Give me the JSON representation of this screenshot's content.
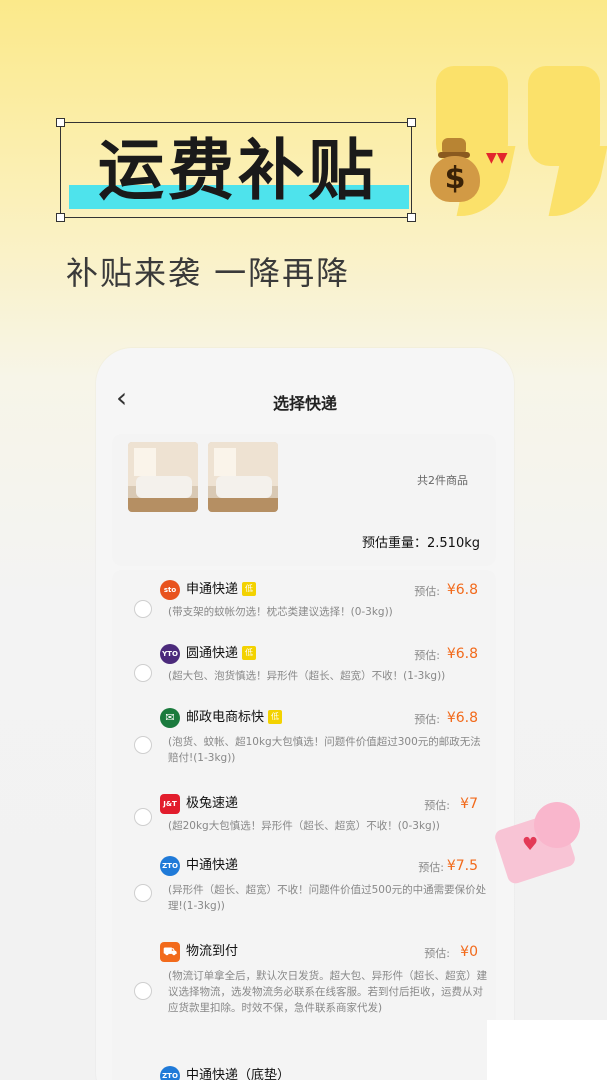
{
  "headline": "运费补贴",
  "subtitle": "补贴来袭 一降再降",
  "bag_symbol": "$",
  "arrows": "▼▼",
  "screen": {
    "back_icon": "chevron-left-icon",
    "title": "选择快递",
    "goods_count": "共2件商品",
    "weight": "预估重量：2.510kg",
    "carriers": [
      {
        "name": "申通快递",
        "logo": "sto",
        "logo_color": "#e8531e",
        "low_badge": "低",
        "est": "预估:",
        "price": "¥6.8",
        "desc": "(带支架的蚊帐勿选！枕芯类建议选择！(0-3kg))"
      },
      {
        "name": "圆通快递",
        "logo": "YTO",
        "logo_color": "#4b2a7b",
        "low_badge": "低",
        "est": "预估:",
        "price": "¥6.8",
        "desc": "(超大包、泡货慎选！异形件（超长、超宽）不收！(1-3kg))"
      },
      {
        "name": "邮政电商标快",
        "logo": "✉",
        "logo_color": "#1a7a3d",
        "low_badge": "低",
        "est": "预估:",
        "price": "¥6.8",
        "desc": "(泡货、蚊帐、超10kg大包慎选！问题件价值超过300元的邮政无法赔付!(1-3kg))"
      },
      {
        "name": "极兔速递",
        "logo": "J&T",
        "logo_color": "#e21d2c",
        "low_badge": "",
        "est": "预估:",
        "price": "¥7",
        "desc": "(超20kg大包慎选！异形件（超长、超宽）不收！(0-3kg))"
      },
      {
        "name": "中通快递",
        "logo": "ZTO",
        "logo_color": "#1f7ad8",
        "low_badge": "",
        "est": "预估:",
        "price": "¥7.5",
        "desc": "(异形件（超长、超宽）不收！问题件价值过500元的中通需要保价处理!(1-3kg))"
      },
      {
        "name": "物流到付",
        "logo": "⛟",
        "logo_color": "#f26a1b",
        "low_badge": "",
        "est": "预估:",
        "price": "¥0",
        "desc": "(物流订单拿全后，默认次日发货。超大包、异形件（超长、超宽）建议选择物流，选发物流务必联系在线客服。若到付后拒收，运费从对应货款里扣除。时效不保，急件联系商家代发)"
      },
      {
        "name": "中通快递（底垫）",
        "logo": "ZTO",
        "logo_color": "#1f7ad8",
        "low_badge": "",
        "est": "",
        "price": "",
        "desc": ""
      }
    ]
  }
}
